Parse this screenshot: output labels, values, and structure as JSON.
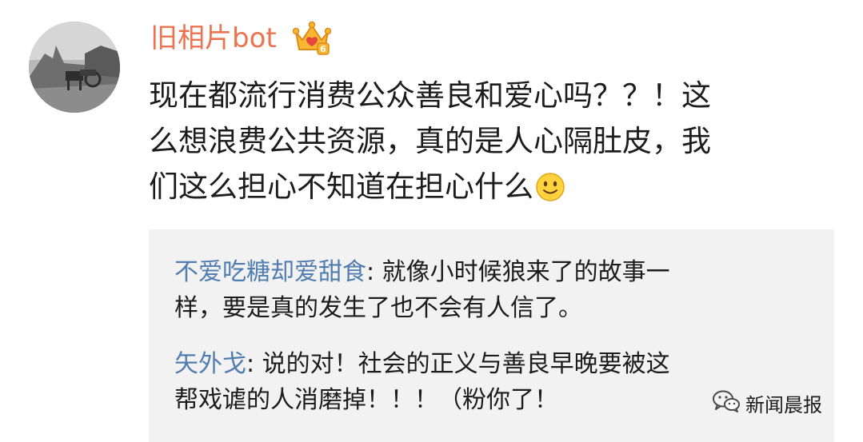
{
  "post": {
    "username": "旧相片bot",
    "badge_icon": "crown-badge-icon",
    "comment_lines": [
      "现在都流行消费公众善良和爱心吗？？！这",
      "么想浪费公共资源，真的是人心隔肚皮，我",
      "们这么担心不知道在担心什么"
    ],
    "emoji": "smile-emoji-icon"
  },
  "replies": [
    {
      "user": "不爱吃糖却爱甜食",
      "line1_rest": ": 就像小时候狼来了的故事一",
      "line2": "样，要是真的发生了也不会有人信了。"
    },
    {
      "user": "矢外戈",
      "line1_rest": ": 说的对！社会的正义与善良早晚要被这",
      "line2": "帮戏谑的人消磨掉！！！（粉你了！"
    }
  ],
  "watermark": {
    "text": "新闻晨报",
    "icon": "wechat-icon"
  },
  "colors": {
    "username": "#eb7350",
    "reply_user": "#507daf",
    "reply_bg": "#f2f2f2",
    "text": "#1c1c1c"
  }
}
